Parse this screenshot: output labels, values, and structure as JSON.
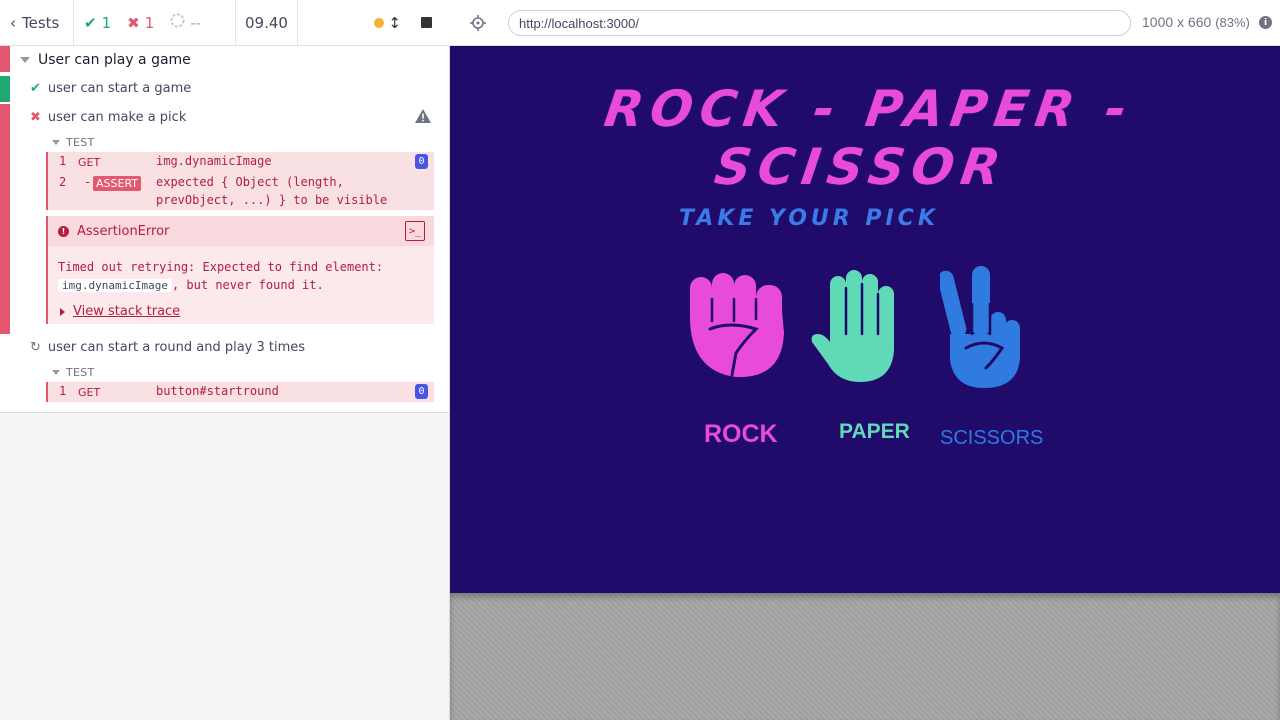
{
  "reporter": {
    "header": {
      "tests_label": "Tests",
      "passed_count": "1",
      "failed_count": "1",
      "pending_count": "--",
      "duration": "09.40"
    },
    "suite": {
      "title": "User can play a game",
      "tests": [
        {
          "title": "user can start a game",
          "state": "passed"
        },
        {
          "title": "user can make a pick",
          "state": "failed",
          "section_label": "TEST",
          "commands": [
            {
              "number": "1",
              "name": "GET",
              "message": "img.dynamicImage",
              "count": "0"
            },
            {
              "number": "2",
              "prefix": "-",
              "name": "ASSERT",
              "message_line1": "expected { Object (length,",
              "message_line2": "prevObject, ...) } to be visible"
            }
          ],
          "error": {
            "name": "AssertionError",
            "message_part1": "Timed out retrying: Expected to find element:",
            "code": "img.dynamicImage",
            "message_part2": ", but never found it.",
            "stack_link": "View stack trace"
          }
        },
        {
          "title": "user can start a round and play 3 times",
          "state": "running",
          "section_label": "TEST",
          "commands": [
            {
              "number": "1",
              "name": "GET",
              "message": "button#startround",
              "count": "0"
            }
          ]
        }
      ]
    }
  },
  "aut": {
    "url": "http://localhost:3000/",
    "viewport_size": "1000 x 660",
    "zoom": "(83%)",
    "game": {
      "title": "ROCK - PAPER - SCISSOR",
      "pick_heading": "TAKE YOUR PICK",
      "choices": [
        {
          "label": "ROCK",
          "color": "#e84bdc",
          "icon": "fist-icon"
        },
        {
          "label": "PAPER",
          "color": "#5fd9b6",
          "icon": "open-hand-icon"
        },
        {
          "label": "SCISSORS",
          "color": "#2f7be0",
          "icon": "peace-hand-icon"
        }
      ]
    }
  },
  "colors": {
    "aut_background": "#200b6b",
    "fail": "#e45770",
    "pass": "#1fa971"
  }
}
